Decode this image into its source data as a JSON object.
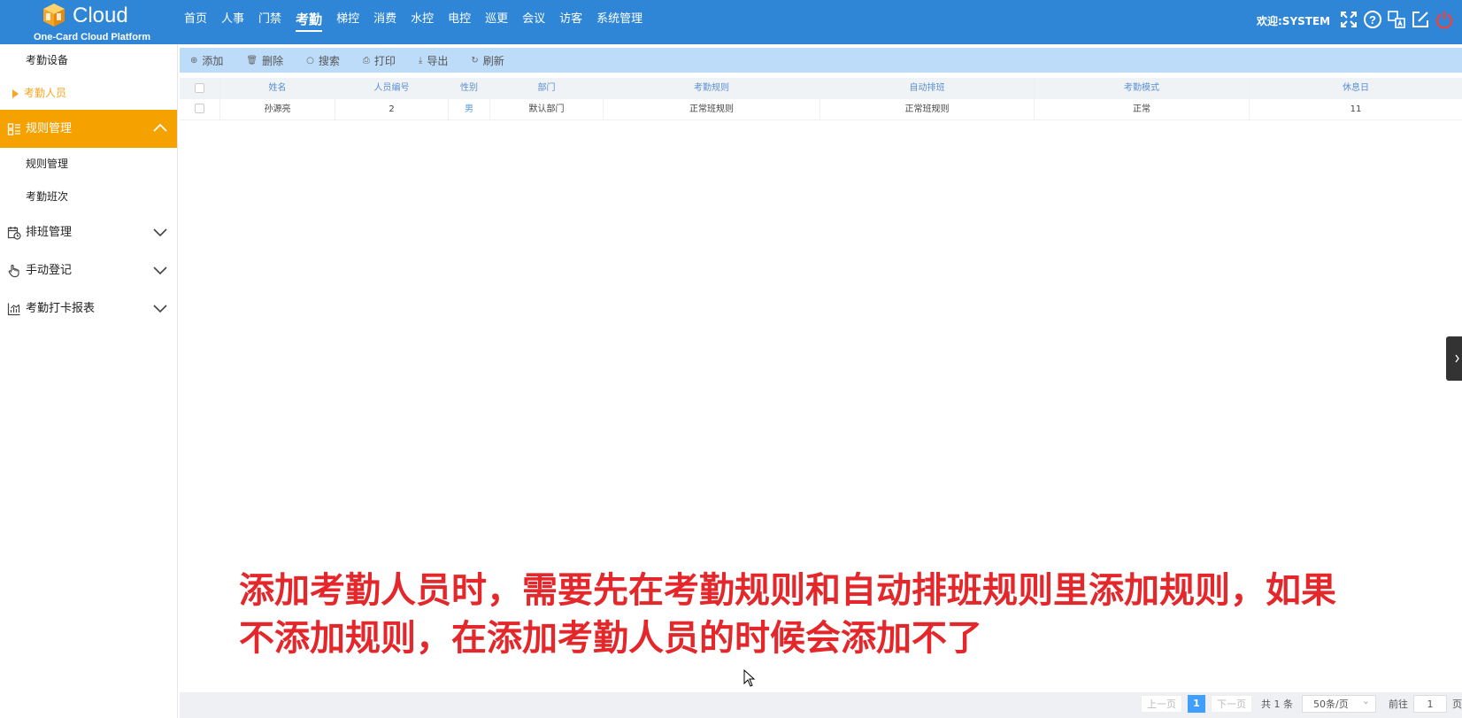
{
  "brand": {
    "name": "Cloud",
    "subtitle": "One-Card Cloud Platform"
  },
  "nav": [
    "首页",
    "人事",
    "门禁",
    "考勤",
    "梯控",
    "消费",
    "水控",
    "电控",
    "巡更",
    "会议",
    "访客",
    "系统管理"
  ],
  "nav_active": "考勤",
  "header": {
    "welcome": "欢迎:SYSTEM"
  },
  "sidebar": {
    "sub_top": [
      "考勤设备",
      "考勤人员"
    ],
    "group_rules": "规则管理",
    "sub_rules": [
      "规则管理",
      "考勤班次"
    ],
    "group_schedule": "排班管理",
    "group_manual": "手动登记",
    "group_report": "考勤打卡报表"
  },
  "toolbar": {
    "add": "添加",
    "delete": "删除",
    "search": "搜索",
    "print": "打印",
    "export": "导出",
    "refresh": "刷新"
  },
  "table": {
    "headers": [
      "姓名",
      "人员编号",
      "性别",
      "部门",
      "考勤规则",
      "自动排班",
      "考勤模式",
      "休息日"
    ],
    "rows": [
      [
        "孙源亮",
        "2",
        "男",
        "默认部门",
        "正常班规则",
        "正常班规则",
        "正常",
        "11"
      ]
    ]
  },
  "caption": {
    "line1": "添加考勤人员时，需要先在考勤规则和自动排班规则里添加规则，如果",
    "line2": "不添加规则，在添加考勤人员的时候会添加不了"
  },
  "pager": {
    "prev": "上一页",
    "current": "1",
    "next": "下一页",
    "total": "共 1 条",
    "page_size": "50条/页",
    "goto": "前往",
    "goto_value": "1",
    "page_unit": "页"
  },
  "colors": {
    "header_bg": "#2f86d6",
    "active_menu": "#f5a200",
    "toolbar_bg": "#bcdcf9",
    "caption": "#e3272a"
  }
}
